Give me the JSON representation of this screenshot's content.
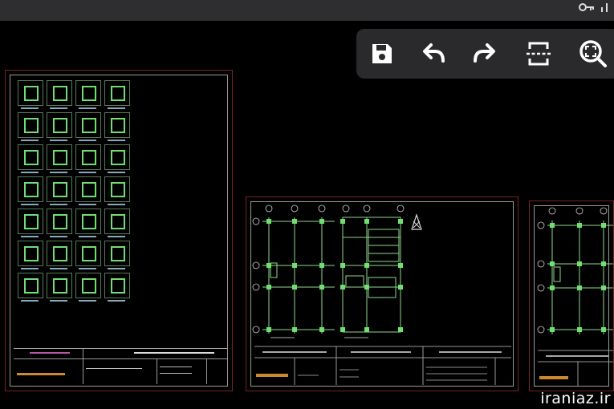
{
  "status_bar": {
    "icons": [
      "key-icon",
      "signal-icon"
    ]
  },
  "toolbar": {
    "buttons": [
      "save-icon",
      "undo-icon",
      "redo-icon",
      "fit-view-icon",
      "zoom-extents-icon"
    ]
  },
  "colors": {
    "background": "#000000",
    "toolbar": "#2a2a2c",
    "sheet_border": "#7a2222",
    "drawing_green": "#6fe06f"
  },
  "watermark": "iraniaz.ir"
}
